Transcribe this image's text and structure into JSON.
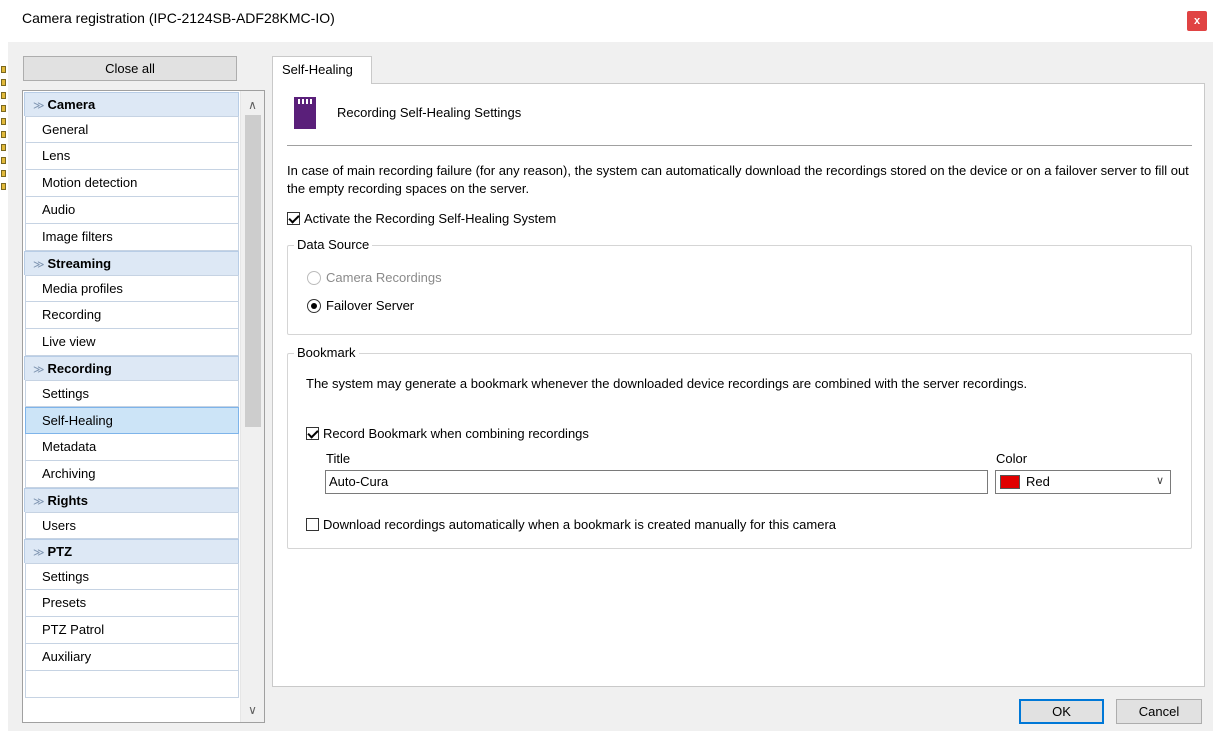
{
  "window": {
    "title": "Camera registration (IPC-2124SB-ADF28KMC-IO)",
    "close_glyph": "x"
  },
  "sidebar": {
    "close_all_label": "Close all",
    "groups": [
      {
        "label": "Camera",
        "items": [
          "General",
          "Lens",
          "Motion detection",
          "Audio",
          "Image filters"
        ]
      },
      {
        "label": "Streaming",
        "items": [
          "Media profiles",
          "Recording",
          "Live view"
        ]
      },
      {
        "label": "Recording",
        "items": [
          "Settings",
          "Self-Healing",
          "Metadata",
          "Archiving"
        ]
      },
      {
        "label": "Rights",
        "items": [
          "Users"
        ]
      },
      {
        "label": "PTZ",
        "items": [
          "Settings",
          "Presets",
          "PTZ Patrol",
          "Auxiliary"
        ]
      }
    ],
    "selected_item": "Self-Healing"
  },
  "tab": {
    "label": "Self-Healing"
  },
  "self_healing": {
    "icon": "sd-card-icon",
    "section_title": "Recording Self-Healing Settings",
    "description": "In case of main recording failure (for any reason), the system can automatically download the recordings stored on the device or on a failover server to fill out the empty recording spaces on the server.",
    "activate_label": "Activate the Recording Self-Healing System",
    "activate_checked": true,
    "data_source": {
      "label": "Data Source",
      "option_camera": "Camera Recordings",
      "option_failover": "Failover Server",
      "selected": "Failover Server"
    },
    "bookmark": {
      "label": "Bookmark",
      "description": "The system may generate a bookmark whenever the downloaded device recordings are combined with the server recordings.",
      "record_label": "Record Bookmark when combining recordings",
      "record_checked": true,
      "title_label": "Title",
      "title_value": "Auto-Cura",
      "color_label": "Color",
      "color_value": "Red",
      "color_hex": "#e00000",
      "download_label": "Download recordings automatically when a bookmark is created manually for this camera",
      "download_checked": false
    }
  },
  "footer": {
    "ok_label": "OK",
    "cancel_label": "Cancel"
  },
  "colors": {
    "selection": "#cce4f7",
    "group_header": "#dde8f5",
    "accent": "#0078d7",
    "sd_icon": "#5a1f7a"
  }
}
